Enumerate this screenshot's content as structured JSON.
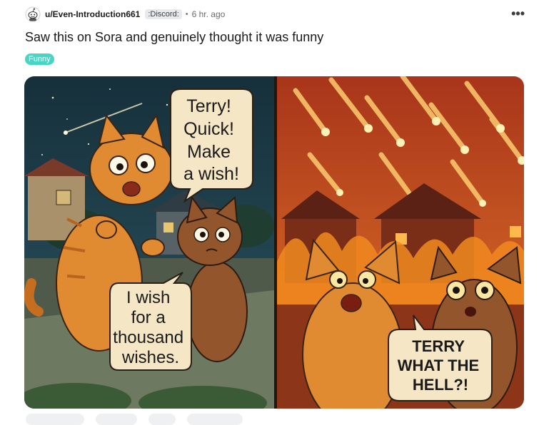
{
  "post": {
    "username": "u/Even-Introduction661",
    "user_flair": ":Discord:",
    "separator": "•",
    "time_ago": "6 hr. ago",
    "more_label": "•••",
    "title": "Saw this on Sora and genuinely thought it was funny",
    "tag": "Funny"
  },
  "comic": {
    "panel1_bubble_top": [
      "Terry!",
      "Quick!",
      "Make",
      "a wish!"
    ],
    "panel1_bubble_bottom": [
      "I wish",
      "for a",
      "thousand",
      "wishes."
    ],
    "panel2_bubble": [
      "TERRY",
      "WHAT THE",
      "HELL?!"
    ]
  },
  "colors": {
    "tag_bg": "#49d5c4",
    "night_sky": "#1e3b48",
    "fire_sky": "#c94a1a",
    "cat_orange": "#e08a32",
    "bubble": "#f5e6c6"
  },
  "icons": {
    "avatar": "reddit-snoo-avatar",
    "more": "more-options-icon"
  }
}
